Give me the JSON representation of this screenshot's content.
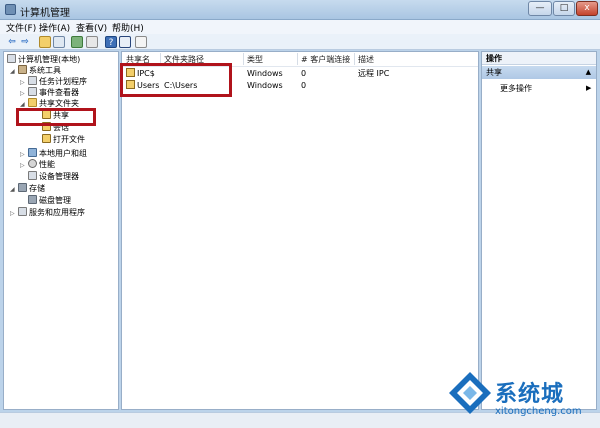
{
  "window": {
    "title": "计算机管理",
    "controls": {
      "minimize": "—",
      "maximize": "□",
      "close": "x"
    }
  },
  "menu": [
    "文件(F)",
    "操作(A)",
    "查看(V)",
    "帮助(H)"
  ],
  "toolbar": {
    "back": "⇦",
    "forward": "⇨",
    "help": "?"
  },
  "tree": [
    {
      "label": "计算机管理(本地)",
      "arrow": "",
      "icon": "computer"
    },
    {
      "label": "系统工具",
      "arrow": "◢",
      "icon": "tools"
    },
    {
      "label": "任务计划程序",
      "arrow": "▷",
      "icon": "task"
    },
    {
      "label": "事件查看器",
      "arrow": "▷",
      "icon": "event"
    },
    {
      "label": "共享文件夹",
      "arrow": "◢",
      "icon": "folder"
    },
    {
      "label": "共享",
      "arrow": "",
      "icon": "share"
    },
    {
      "label": "会话",
      "arrow": "",
      "icon": "share"
    },
    {
      "label": "打开文件",
      "arrow": "",
      "icon": "share"
    },
    {
      "label": "本地用户和组",
      "arrow": "▷",
      "icon": "users"
    },
    {
      "label": "性能",
      "arrow": "▷",
      "icon": "perf"
    },
    {
      "label": "设备管理器",
      "arrow": "",
      "icon": "device"
    },
    {
      "label": "存储",
      "arrow": "◢",
      "icon": "storage"
    },
    {
      "label": "磁盘管理",
      "arrow": "",
      "icon": "disk"
    },
    {
      "label": "服务和应用程序",
      "arrow": "▷",
      "icon": "services"
    }
  ],
  "table": {
    "columns": [
      "共享名",
      "文件夹路径",
      "类型",
      "# 客户端连接",
      "描述"
    ],
    "rows": [
      {
        "name": "IPC$",
        "path": "",
        "type": "Windows",
        "clients": "0",
        "desc": "远程 IPC"
      },
      {
        "name": "Users",
        "path": "C:\\Users",
        "type": "Windows",
        "clients": "0",
        "desc": ""
      }
    ]
  },
  "actions": {
    "header": "操作",
    "section": "共享",
    "section_caret": "▲",
    "more": "更多操作",
    "more_arrow": "▶"
  },
  "watermark": {
    "brand": "系统城",
    "site": "xitongcheng.com"
  },
  "colors": {
    "highlight_box": "#b0131b",
    "brand_blue": "#1a6ebd"
  }
}
